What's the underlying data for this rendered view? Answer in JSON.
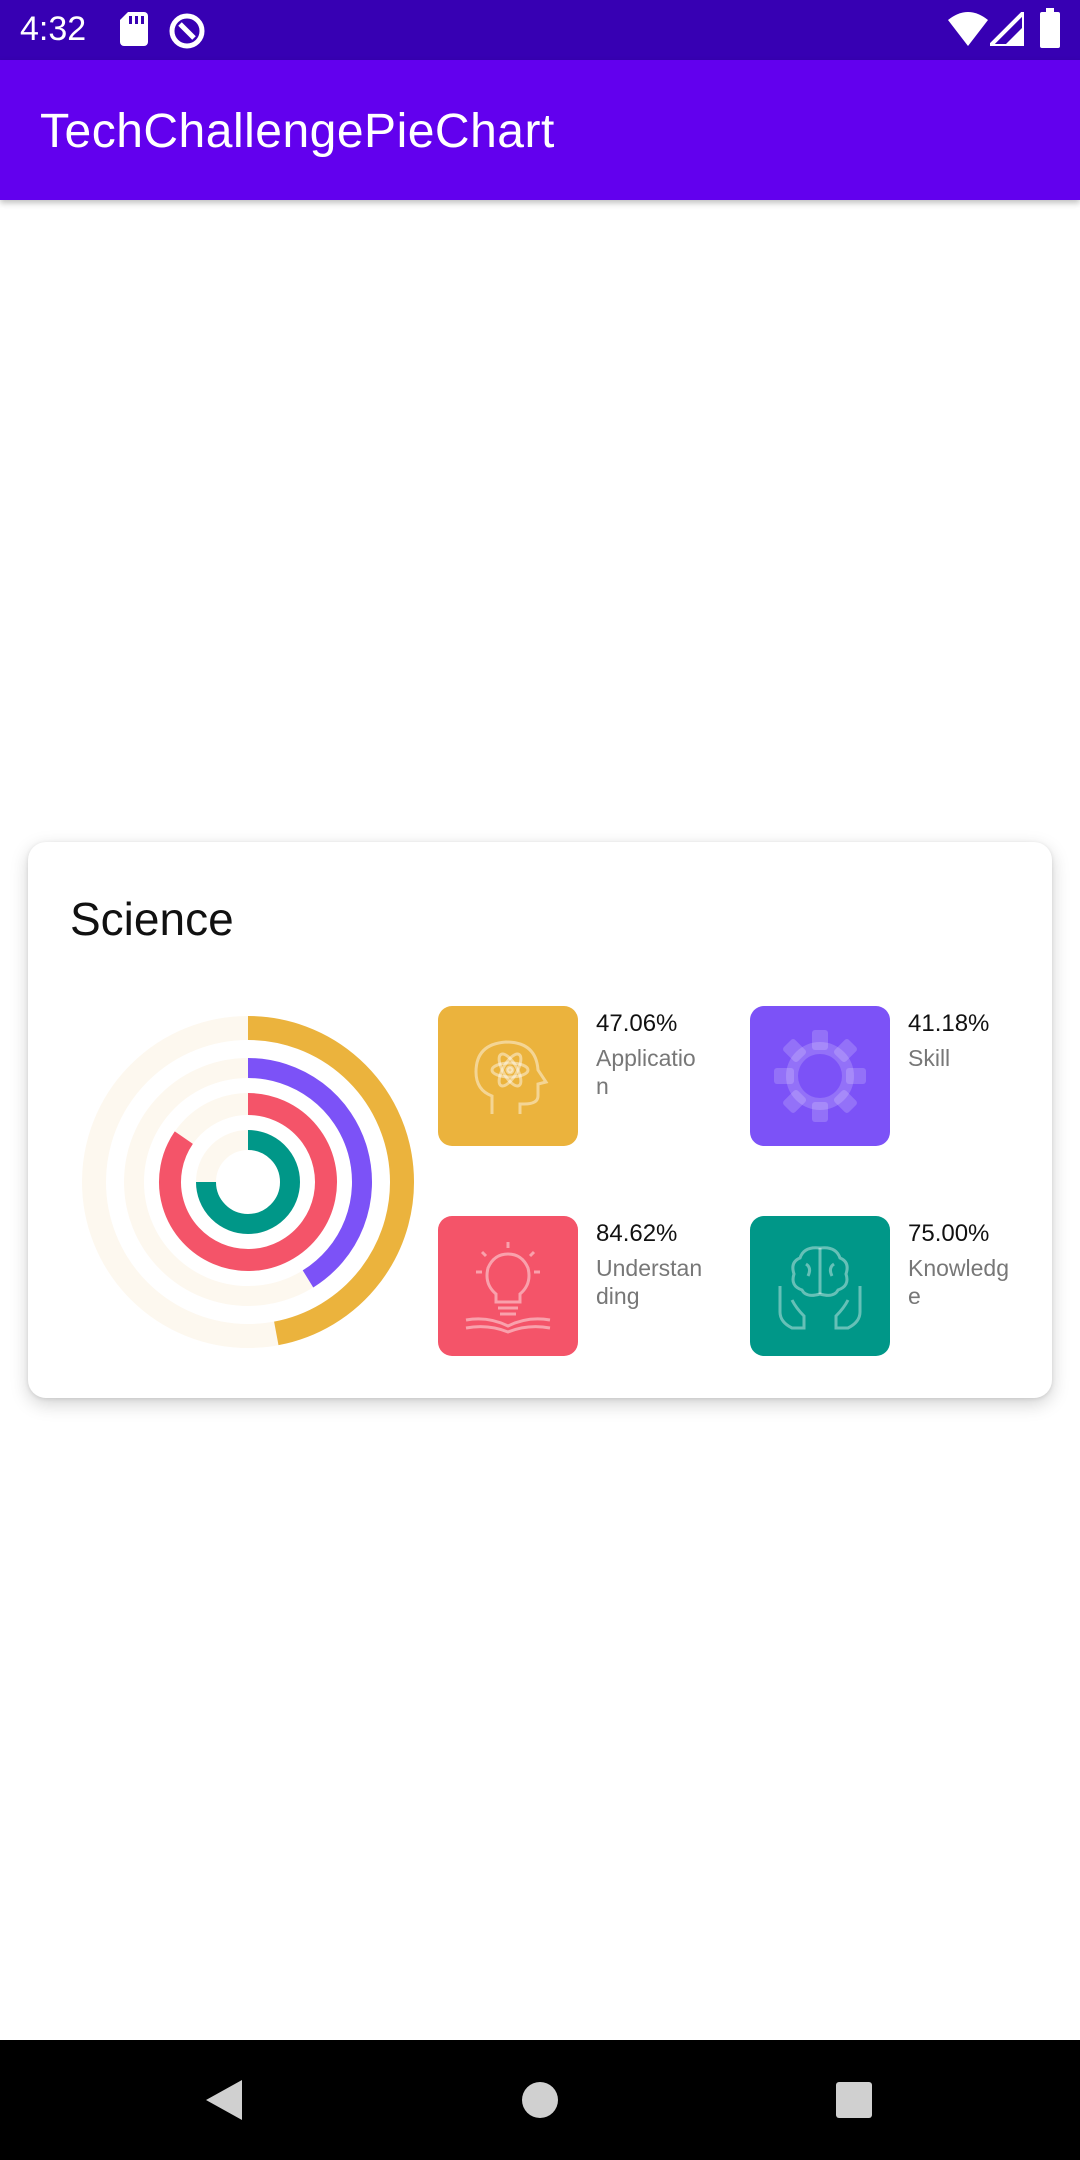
{
  "status_bar": {
    "time": "4:32",
    "icons": [
      "sd-card-icon",
      "data-saver-icon",
      "wifi-icon",
      "signal-icon",
      "battery-icon"
    ]
  },
  "app_bar": {
    "title": "TechChallengePieChart"
  },
  "card": {
    "title": "Science",
    "legend": [
      {
        "value": "47.06%",
        "label": "Application",
        "color": "#ebb33d",
        "icon": "head-atom-icon"
      },
      {
        "value": "41.18%",
        "label": "Skill",
        "color": "#7c52f7",
        "icon": "gear-icon"
      },
      {
        "value": "84.62%",
        "label": "Understanding",
        "color": "#f45469",
        "icon": "lightbulb-book-icon"
      },
      {
        "value": "75.00%",
        "label": "Knowledge",
        "color": "#009788",
        "icon": "brain-hands-icon"
      }
    ]
  },
  "chart_data": {
    "type": "radial-bar",
    "title": "Science",
    "series": [
      {
        "name": "Application",
        "value": 47.06,
        "color": "#ebb33d"
      },
      {
        "name": "Skill",
        "value": 41.18,
        "color": "#7c52f7"
      },
      {
        "name": "Understanding",
        "value": 84.62,
        "color": "#f45469"
      },
      {
        "name": "Knowledge",
        "value": 75.0,
        "color": "#009788"
      }
    ],
    "max": 100,
    "track_color": "#fdf8ef"
  },
  "nav_bar": {
    "buttons": [
      "back-icon",
      "home-icon",
      "recents-icon"
    ]
  }
}
